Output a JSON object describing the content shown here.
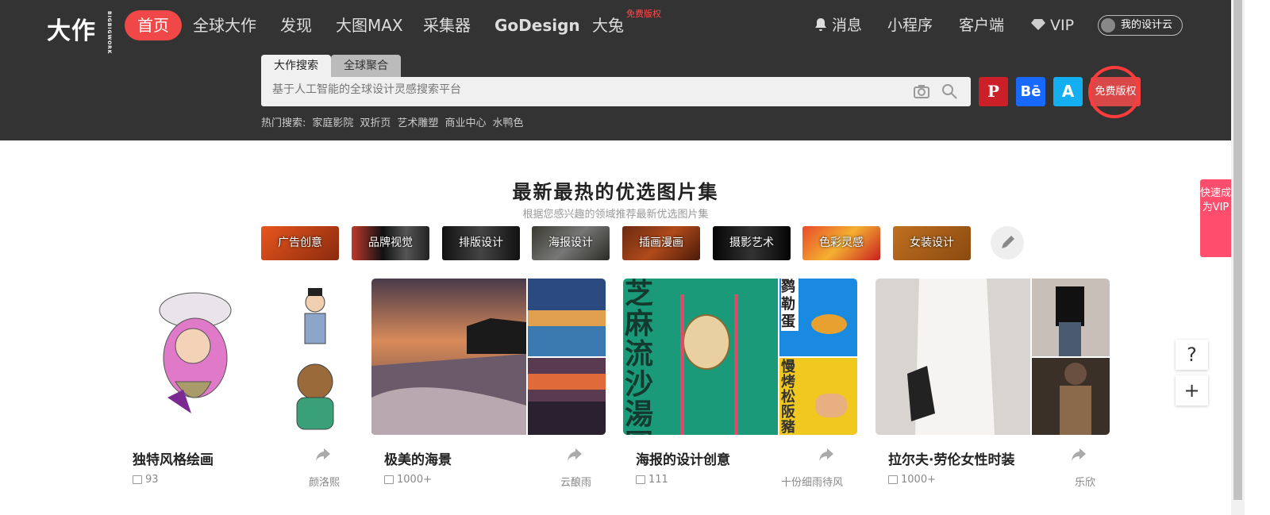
{
  "header": {
    "logo": "大作",
    "logo_sub": "BIGBIGWORK",
    "nav": [
      "首页",
      "全球大作",
      "发现",
      "大图MAX",
      "采集器",
      "GoDesign",
      "大兔"
    ],
    "nav_badge": "免费版权",
    "right_nav": [
      "消息",
      "小程序",
      "客户端",
      "VIP"
    ],
    "cloud": "我的设计云"
  },
  "search": {
    "tabs": [
      "大作搜索",
      "全球聚合"
    ],
    "placeholder": "基于人工智能的全球设计灵感搜索平台",
    "hot_label": "热门搜索:",
    "hot": [
      "家庭影院",
      "双折页",
      "艺术雕塑",
      "商业中心",
      "水鸭色"
    ],
    "ext": {
      "pinterest": "P",
      "behance": "Bē",
      "artstation": "A"
    },
    "free": "免费版权"
  },
  "section": {
    "title": "最新最热的优选图片集",
    "subtitle": "根据您感兴趣的领域推荐最新优选图片集"
  },
  "categories": [
    "广告创意",
    "品牌视觉",
    "排版设计",
    "海报设计",
    "插画漫画",
    "摄影艺术",
    "色彩灵感",
    "女装设计"
  ],
  "side_vip": "快速成为VIP",
  "float": {
    "help": "?",
    "add": "+"
  },
  "cards": [
    {
      "title": "独特风格绘画",
      "count": "93",
      "author": "颜洛熙"
    },
    {
      "title": "极美的海景",
      "count": "1000+",
      "author": "云酿雨"
    },
    {
      "title": "海报的设计创意",
      "count": "111",
      "author": "十份细雨待风"
    },
    {
      "title": "拉尔夫·劳伦女性时装",
      "count": "1000+",
      "author": "乐欣"
    }
  ],
  "poster_text": {
    "left": "芝麻流沙湯圓",
    "top": "鹨勒蛋",
    "bottom": "慢烤松阪豬"
  }
}
